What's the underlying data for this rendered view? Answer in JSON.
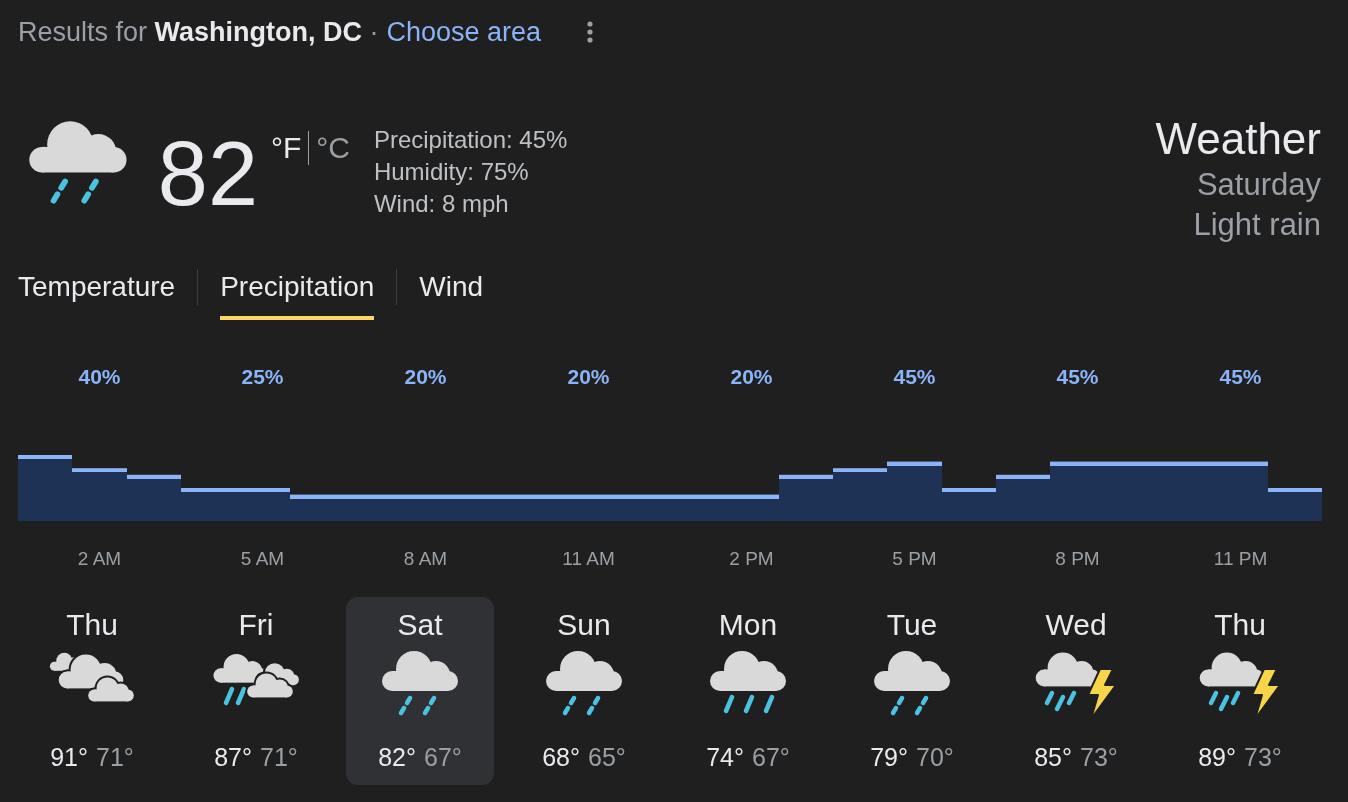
{
  "header": {
    "results": "Results for **Washington, DC** ·",
    "link": "Choose area"
  },
  "current": {
    "temperature": "82",
    "units": [
      {
        "label": "°F",
        "selected": true
      },
      {
        "label": "°C",
        "selected": false
      }
    ],
    "details": [
      "Precipitation: 45%",
      "Humidity: 75%",
      "Wind: 8 mph"
    ],
    "title": "Weather",
    "day": "Saturday",
    "condition": "Light rain"
  },
  "tabs": [
    {
      "label": "Temperature",
      "selected": false
    },
    {
      "label": "Precipitation",
      "selected": true
    },
    {
      "label": "Wind",
      "selected": false
    }
  ],
  "hourly": {
    "chart_data": {
      "type": "bar",
      "categories": [
        null,
        "2 AM",
        null,
        null,
        "5 AM",
        null,
        null,
        "8 AM",
        null,
        null,
        "11 AM",
        null,
        null,
        "2 PM",
        null,
        null,
        "5 PM",
        null,
        null,
        "8 PM",
        null,
        null,
        "11 PM",
        null
      ],
      "values": [
        50,
        40,
        35,
        25,
        25,
        20,
        20,
        20,
        20,
        20,
        20,
        20,
        20,
        20,
        35,
        40,
        45,
        25,
        35,
        45,
        45,
        45,
        45,
        25
      ],
      "value_labels": [
        null,
        "40%",
        null,
        null,
        "25%",
        null,
        null,
        "20%",
        null,
        null,
        "20%",
        null,
        null,
        "20%",
        null,
        null,
        "45%",
        null,
        null,
        "45%",
        null,
        null,
        "45%",
        null
      ]
    }
  },
  "days": [
    {
      "name": "Thu",
      "kind": "cloudy",
      "high": "91°",
      "low": "71°",
      "selected": false
    },
    {
      "name": "Fri",
      "kind": "showers",
      "high": "87°",
      "low": "71°",
      "selected": false
    },
    {
      "name": "Sat",
      "kind": "light-rain",
      "high": "82°",
      "low": "67°",
      "selected": true
    },
    {
      "name": "Sun",
      "kind": "light-rain",
      "high": "68°",
      "low": "65°",
      "selected": false
    },
    {
      "name": "Mon",
      "kind": "rain",
      "high": "74°",
      "low": "67°",
      "selected": false
    },
    {
      "name": "Tue",
      "kind": "light-rain",
      "high": "79°",
      "low": "70°",
      "selected": false
    },
    {
      "name": "Wed",
      "kind": "thunderstorm",
      "high": "85°",
      "low": "73°",
      "selected": false
    },
    {
      "name": "Thu",
      "kind": "thunderstorm",
      "high": "89°",
      "low": "73°",
      "selected": false
    }
  ]
}
